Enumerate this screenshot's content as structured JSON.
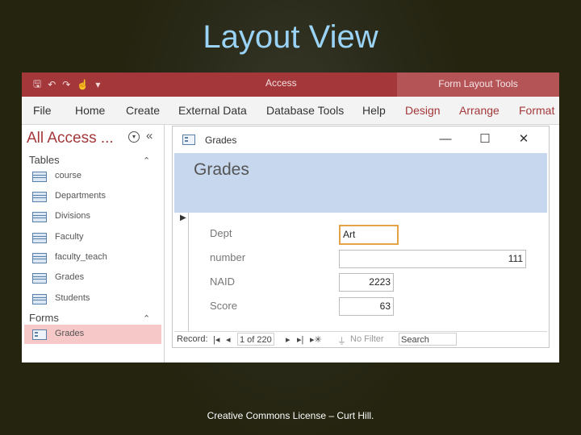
{
  "slide": {
    "title": "Layout View",
    "footer": "Creative Commons License – Curt Hill."
  },
  "titlebar": {
    "app_title": "Access",
    "context_tab": "Form Layout Tools",
    "qat_icons": [
      "save-icon",
      "undo-icon",
      "redo-icon",
      "touch-mode-icon",
      "customize-qat-icon"
    ],
    "qat_glyphs": {
      "save": "🖫",
      "undo": "↶",
      "redo": "↷",
      "touch": "☝",
      "more": "▾"
    }
  },
  "menu": {
    "items": [
      "File",
      "Home",
      "Create",
      "External Data",
      "Database Tools",
      "Help"
    ],
    "context_items": [
      "Design",
      "Arrange",
      "Format"
    ]
  },
  "nav_pane": {
    "header": "All Access ...",
    "dropdown_glyph": "▾",
    "collapse_glyph": "«",
    "group_chevron": "⌃",
    "tables_label": "Tables",
    "tables": [
      "course",
      "Departments",
      "Divisions",
      "Faculty",
      "faculty_teach",
      "Grades",
      "Students"
    ],
    "forms_label": "Forms",
    "forms": [
      "Grades"
    ]
  },
  "document": {
    "tab_title": "Grades",
    "minimize_glyph": "—",
    "maximize_glyph": "☐",
    "close_glyph": "✕",
    "form_title": "Grades",
    "record_selector_glyph": "▶",
    "fields": [
      {
        "label": "Dept",
        "value": "Art"
      },
      {
        "label": "number",
        "value": "111"
      },
      {
        "label": "NAID",
        "value": "2223"
      },
      {
        "label": "Score",
        "value": "63"
      }
    ]
  },
  "record_nav": {
    "label": "Record:",
    "first": "|◂",
    "prev": "◂",
    "position": "1 of 220",
    "next": "▸",
    "last": "▸|",
    "new": "▸✳",
    "filter": "No Filter",
    "filter_icon": "⏚",
    "search_placeholder": "Search"
  },
  "colors": {
    "accent": "#a4373a",
    "context_tab": "#b55457",
    "form_header": "#c7d8ee",
    "selected_nav": "#f6c8c8",
    "focus_border": "#e4a346",
    "slide_title": "#9ad3f5"
  }
}
